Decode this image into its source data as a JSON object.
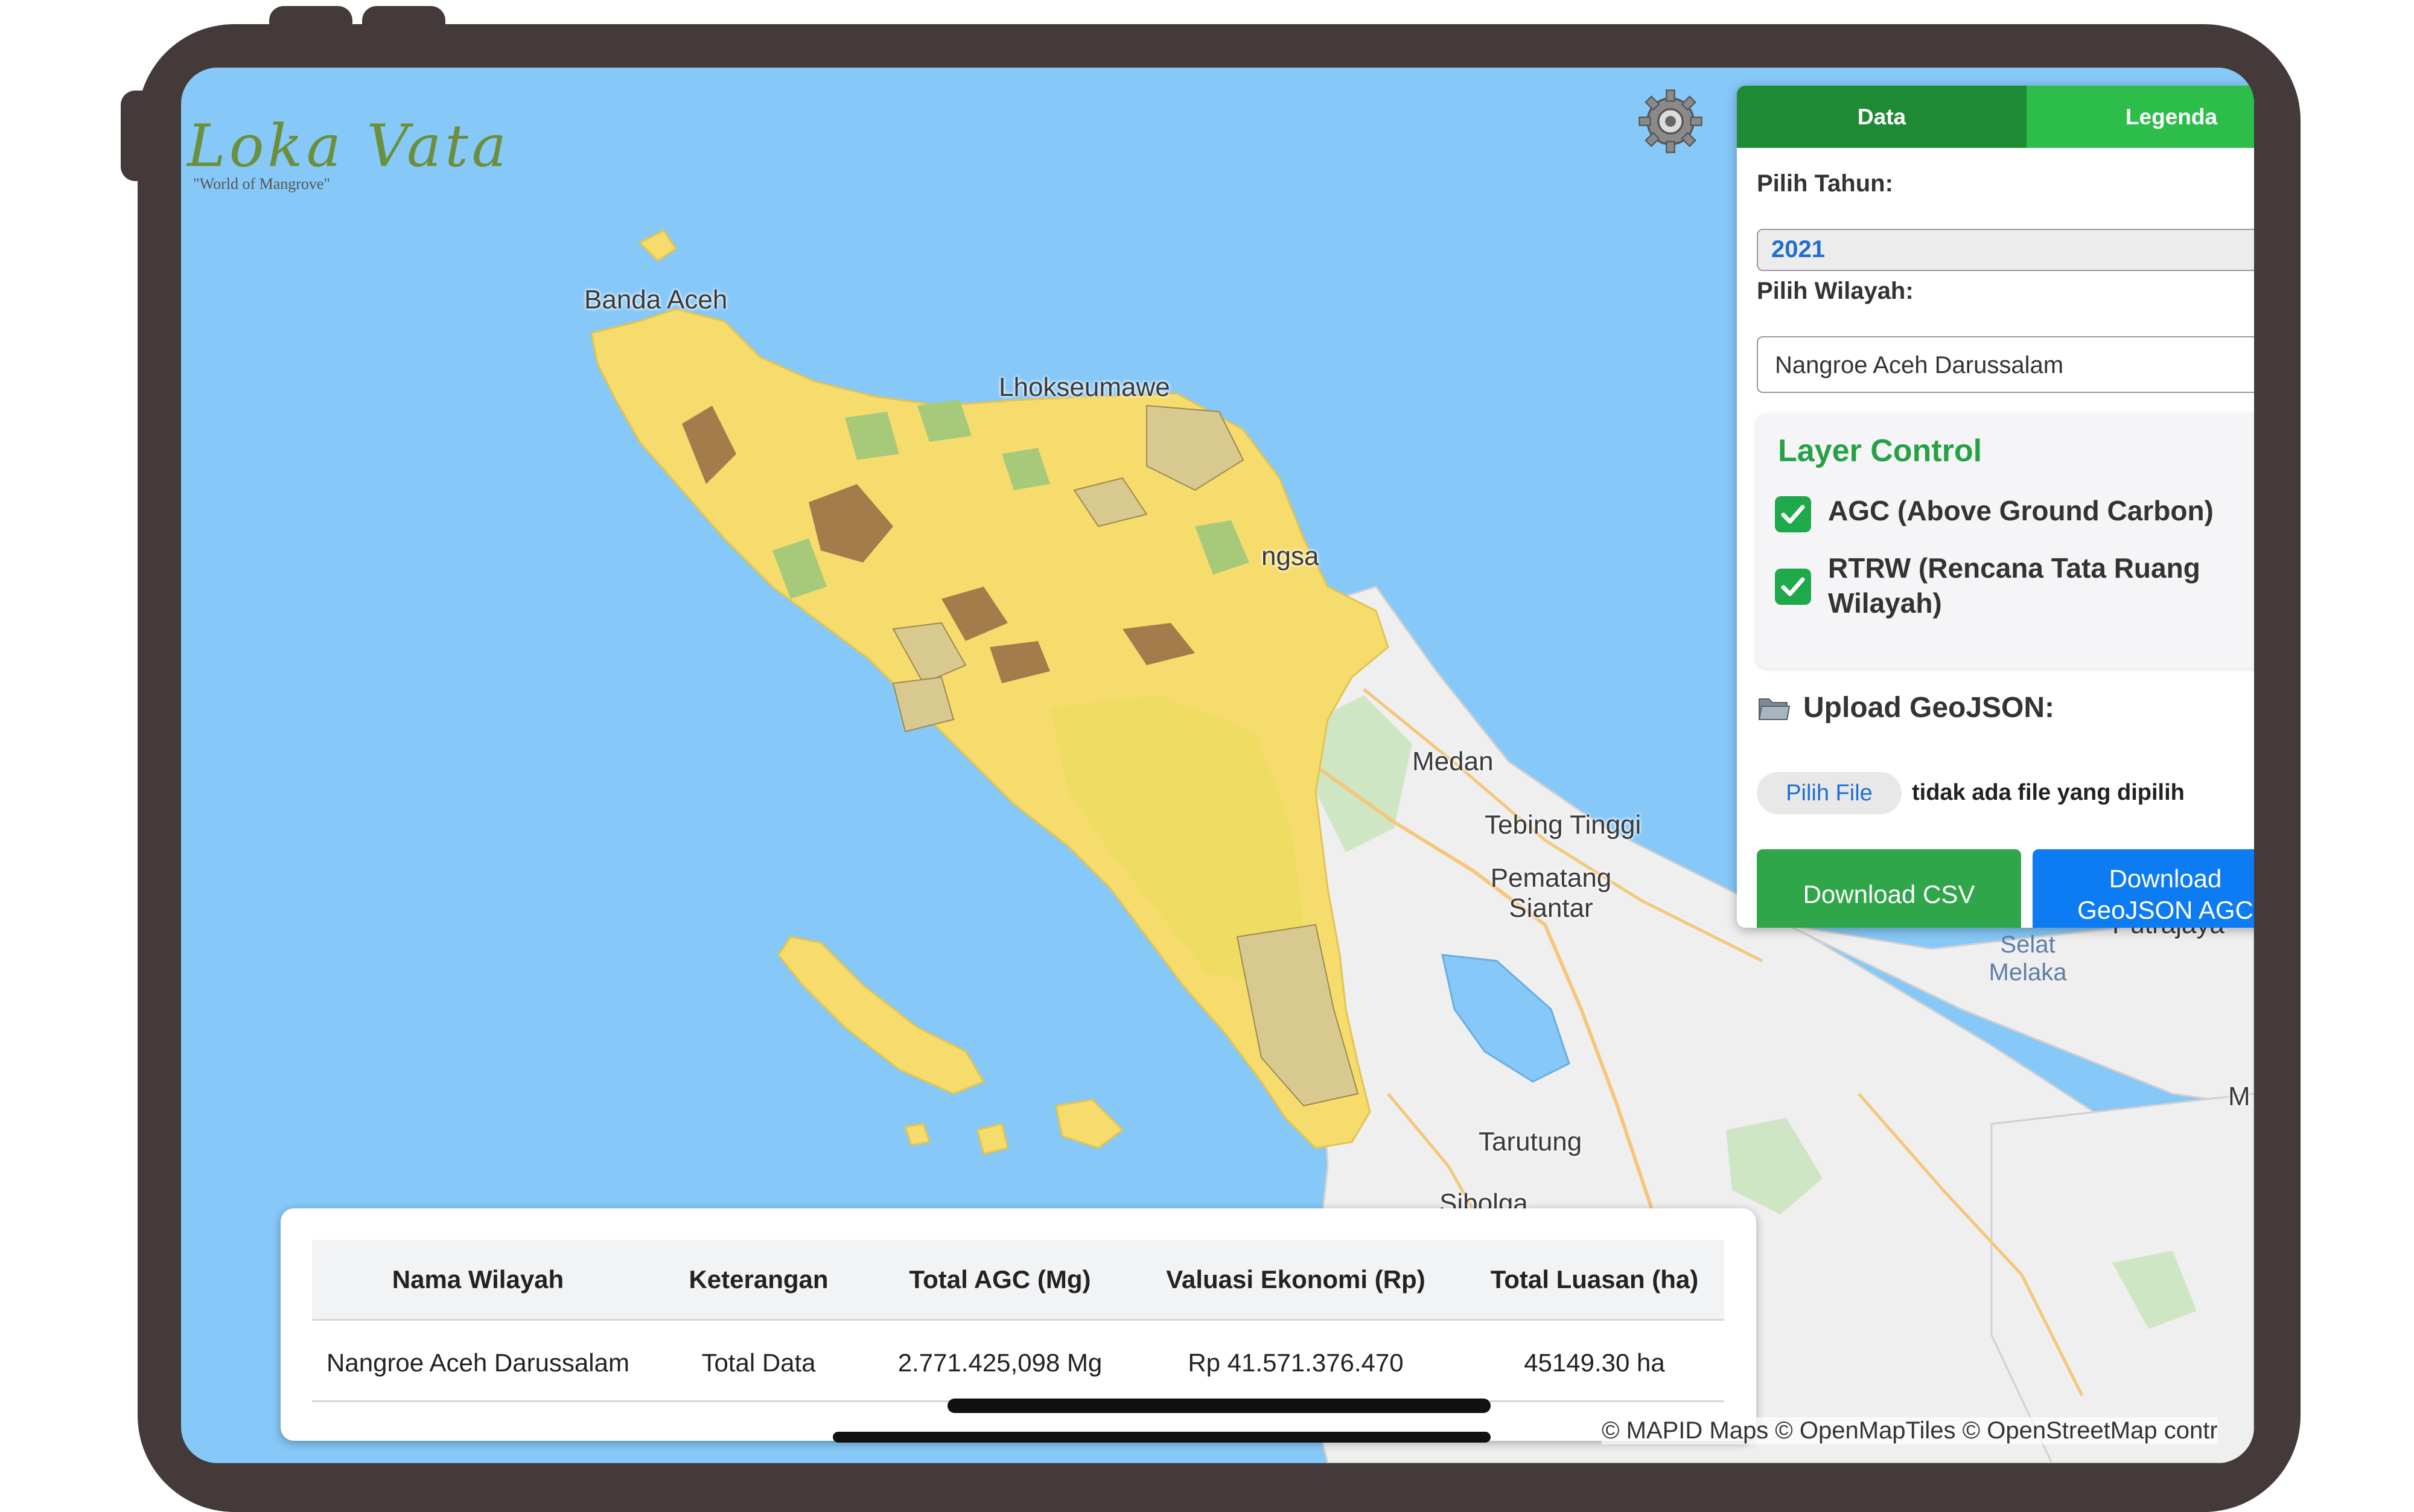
{
  "brand": {
    "title": "Loka Vata",
    "subtitle": "\"World of Mangrove\""
  },
  "icons": {
    "settings": "gear-icon",
    "folder": "folder-icon",
    "check": "check-icon"
  },
  "colors": {
    "tab_active": "#1f8a34",
    "tab_inactive": "#2dbd4b",
    "layer_title": "#27a046",
    "checkbox": "#1ea94b",
    "download_csv": "#2fa64a",
    "download_geojson": "#0d7bf2",
    "link_blue": "#1f6fd1",
    "region_fill": "#f6dc6c",
    "sea": "#86c8f7"
  },
  "map": {
    "places": {
      "banda_aceh": "Banda Aceh",
      "lhokseumawe": "Lhokseumawe",
      "langsa": "ngsa",
      "medan": "Medan",
      "tebing_tinggi": "Tebing Tinggi",
      "pematang": "Pematang",
      "siantar": "Siantar",
      "tarutung": "Tarutung",
      "sibolga": "Sibolga",
      "putrajaya": "Putrajaya",
      "selat": "Selat",
      "melaka": "Melaka",
      "edge_m": "M"
    },
    "attribution": "© MAPID Maps © OpenMapTiles © OpenStreetMap contr"
  },
  "panel": {
    "tabs": [
      "Data",
      "Legenda"
    ],
    "year_label": "Pilih Tahun:",
    "year_value": "2021",
    "region_label": "Pilih Wilayah:",
    "region_value": "Nangroe Aceh Darussalam",
    "layer_control": {
      "title": "Layer Control",
      "layers": [
        {
          "label": "AGC (Above Ground Carbon)",
          "checked": true
        },
        {
          "label_line1": "RTRW (Rencana Tata Ruang",
          "label_line2": "Wilayah)",
          "checked": true
        }
      ]
    },
    "upload_label": "Upload GeoJSON:",
    "file_button": "Pilih File",
    "file_status": "tidak ada file yang dipilih",
    "download_csv": "Download CSV",
    "download_geojson_line1": "Download",
    "download_geojson_line2": "GeoJSON AGC"
  },
  "table": {
    "headers": [
      "Nama Wilayah",
      "Keterangan",
      "Total AGC (Mg)",
      "Valuasi Ekonomi (Rp)",
      "Total Luasan (ha)"
    ],
    "rows": [
      [
        "Nangroe Aceh Darussalam",
        "Total Data",
        "2.771.425,098 Mg",
        "Rp 41.571.376.470",
        "45149.30 ha"
      ]
    ]
  }
}
